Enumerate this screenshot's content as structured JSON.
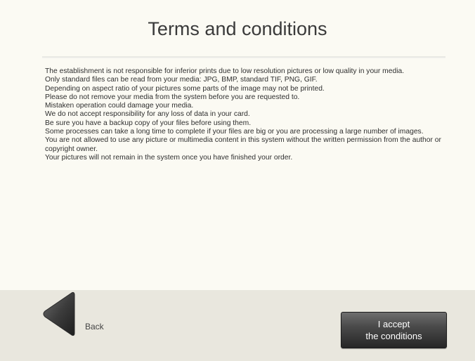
{
  "header": {
    "title": "Terms and conditions"
  },
  "terms": [
    "The establishment is not responsible for inferior prints due to low resolution pictures or low quality in your media.",
    "Only standard files can be read from your media: JPG, BMP, standard TIF, PNG, GIF.",
    "Depending on aspect ratio of your pictures some parts of the image may not be printed.",
    "Please do not remove your media from the system before you are requested to.",
    "Mistaken operation could damage your media.",
    "We do not accept responsibility for any loss of data in your card.",
    "Be sure you have a backup copy of your files before using them.",
    "Some processes can take a long time to complete if your files are big or you are processing a large number of images.",
    "You are not allowed to use any picture or multimedia content in this system without the written permission from the author or copyright owner.",
    "Your pictures will not remain in the system once you have finished your order."
  ],
  "footer": {
    "back_label": "Back",
    "back_icon": "triangle-left-icon",
    "accept_line1": "I accept",
    "accept_line2": "the conditions"
  },
  "colors": {
    "background": "#fbfaf3",
    "footer": "#e9e7de",
    "accept_button": "#3c3c3c"
  }
}
